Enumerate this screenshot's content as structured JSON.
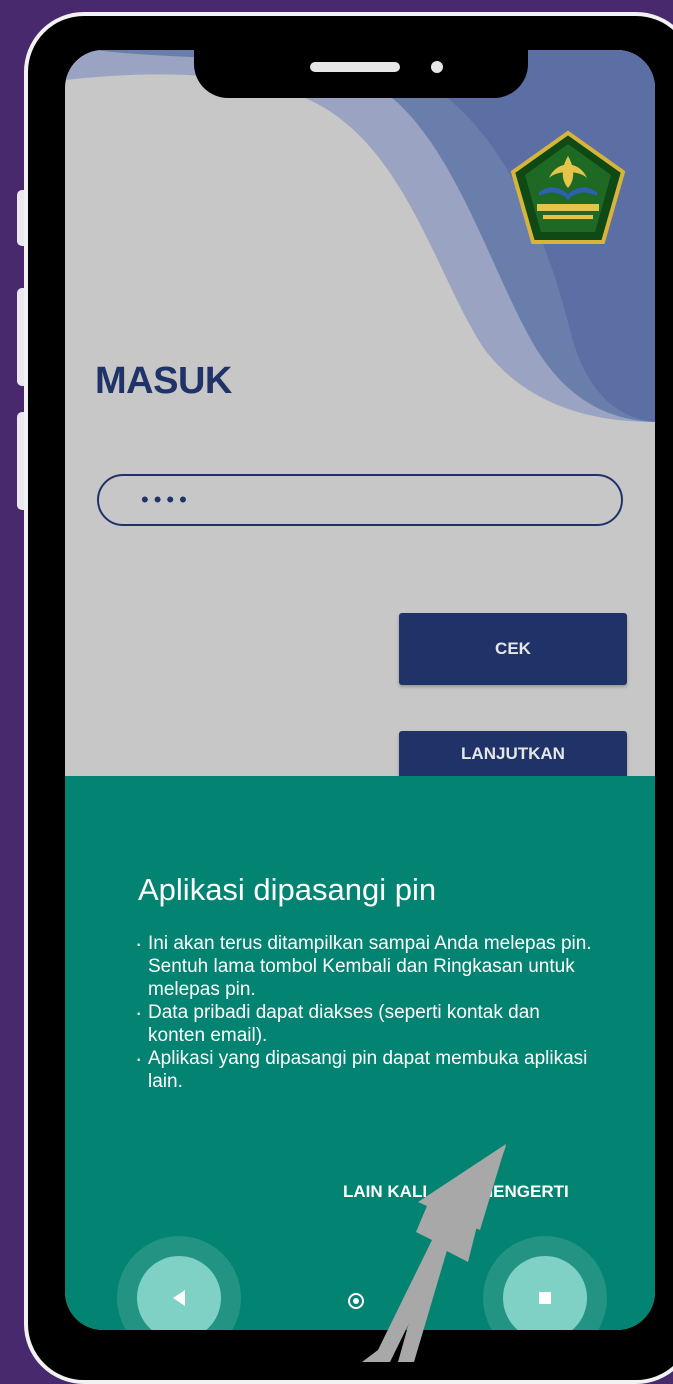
{
  "colors": {
    "page_background": "#48296e",
    "app_background": "#c7c7c7",
    "brand_navy": "#1f3368",
    "sheet_teal": "#038371",
    "nav_button": "#7fd0c5",
    "arrow_gray": "#a8a8a8"
  },
  "login": {
    "title": "MASUK",
    "pin_value": "••••",
    "check_button": "CEK",
    "continue_button": "LANJUTKAN",
    "logo_icon": "madrasah-emblem-icon"
  },
  "pin_dialog": {
    "title": "Aplikasi dipasangi pin",
    "bullets": [
      "Ini akan terus ditampilkan sampai Anda melepas pin. Sentuh lama tombol Kembali dan Ringkasan untuk melepas pin.",
      "Data pribadi dapat diakses (seperti kontak dan konten email).",
      "Aplikasi yang dipasangi pin dapat membuka aplikasi lain."
    ],
    "later_button": "LAIN KALI",
    "ok_button": "MENGERTI"
  },
  "nav_bar": {
    "back_icon": "back-triangle-icon",
    "home_icon": "home-circle-icon",
    "recents_icon": "recents-square-icon"
  },
  "annotation_icon": "pointer-arrow-icon"
}
